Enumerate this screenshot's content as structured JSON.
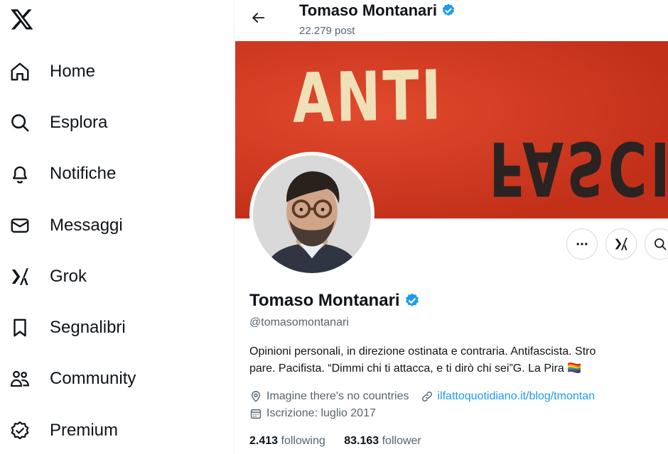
{
  "sidebar": {
    "items": [
      {
        "label": "Home",
        "icon": "home-icon"
      },
      {
        "label": "Esplora",
        "icon": "search-icon"
      },
      {
        "label": "Notifiche",
        "icon": "bell-icon"
      },
      {
        "label": "Messaggi",
        "icon": "mail-icon"
      },
      {
        "label": "Grok",
        "icon": "grok-icon"
      },
      {
        "label": "Segnalibri",
        "icon": "bookmark-icon"
      },
      {
        "label": "Community",
        "icon": "people-icon"
      },
      {
        "label": "Premium",
        "icon": "premium-icon"
      }
    ]
  },
  "header": {
    "name": "Tomaso Montanari",
    "posts": "22.279 post"
  },
  "banner": {
    "top_text": "ANTI",
    "bottom_text": "FASCIS"
  },
  "profile": {
    "name": "Tomaso Montanari",
    "handle": "@tomasomontanari",
    "bio_line1": "Opinioni personali, in direzione ostinata e contraria. Antifascista. Stro",
    "bio_line2": "pare. Pacifista. “Dimmi chi ti attacca, e ti dirò chi sei”G. La Pira 🏳️‍🌈",
    "location": "Imagine there's no countries",
    "website": "ilfattoquotidiano.it/blog/tmontan",
    "joined": "Iscrizione: luglio 2017",
    "following_count": "2.413",
    "following_label": "following",
    "follower_count": "83.163",
    "follower_label": "follower"
  },
  "colors": {
    "accent": "#1d9bf0",
    "banner": "#d63a21",
    "muted": "#536471"
  }
}
